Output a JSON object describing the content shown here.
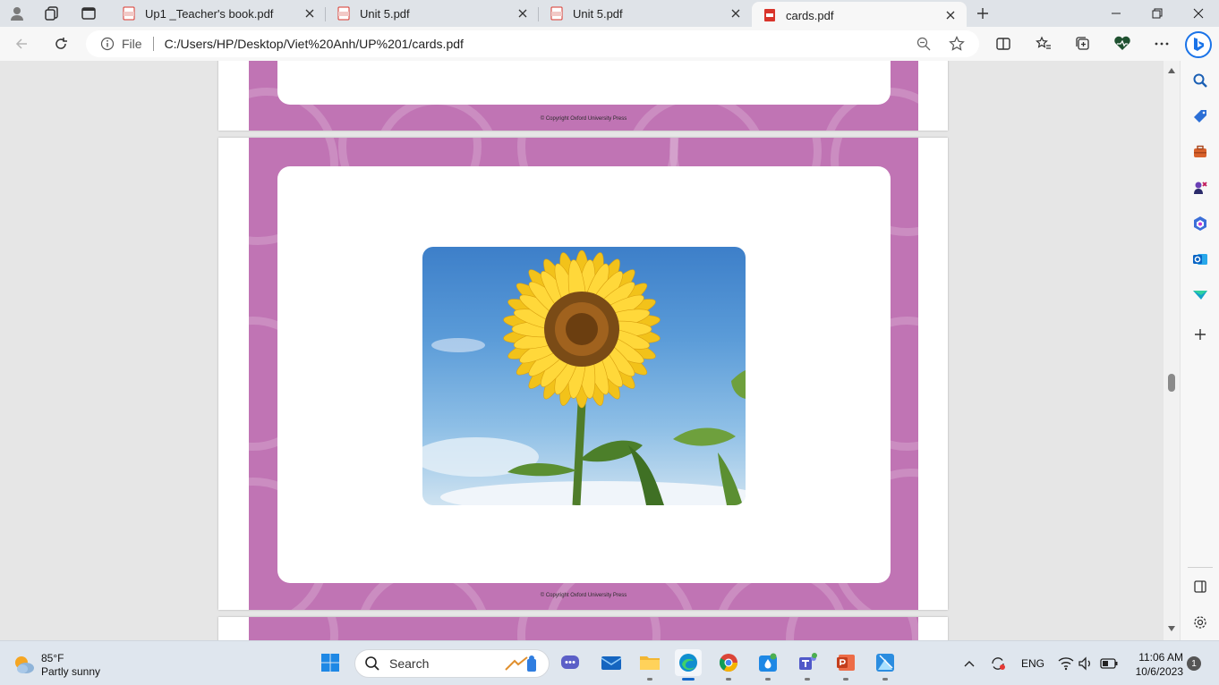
{
  "browser": {
    "tabs": [
      {
        "label": "Up1 _Teacher's book.pdf",
        "active": false
      },
      {
        "label": "Unit 5.pdf",
        "active": false
      },
      {
        "label": "Unit 5.pdf",
        "active": false
      },
      {
        "label": "cards.pdf",
        "active": true
      }
    ],
    "address": {
      "scheme_label": "File",
      "url": "C:/Users/HP/Desktop/Viet%20Anh/UP%201/cards.pdf"
    }
  },
  "pdf": {
    "pages": [
      {
        "copyright": "© Copyright Oxford University Press"
      },
      {
        "copyright": "© Copyright Oxford University Press"
      }
    ],
    "frame_color": "#c074b4"
  },
  "taskbar": {
    "weather": {
      "temp": "85°F",
      "condition": "Partly sunny"
    },
    "search_label": "Search",
    "language": "ENG",
    "time": "11:06 AM",
    "date": "10/6/2023",
    "notification_count": "1"
  },
  "colors": {
    "accent": "#1467c8",
    "tabbar": "#dfe3e8",
    "pdf_icon": "#d9342b"
  }
}
